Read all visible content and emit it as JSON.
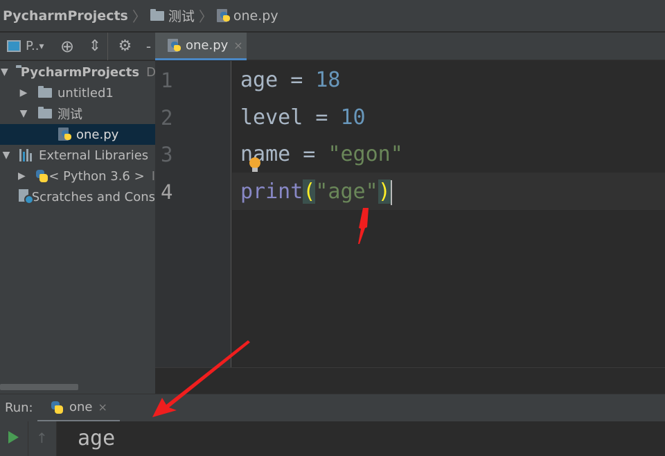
{
  "breadcrumb": {
    "project": "PycharmProjects",
    "folder": "测试",
    "file": "one.py"
  },
  "project_toolbar": {
    "view_label": "P..",
    "view_arrow": "▾",
    "locate_icon": "⊕",
    "collapse_icon": "⇕",
    "settings_icon": "⚙",
    "hide_icon": "-"
  },
  "tree": {
    "root": {
      "label": "PycharmProjects",
      "suffix": "D"
    },
    "items": [
      {
        "label": "untitled1"
      },
      {
        "label": "测试"
      },
      {
        "label": "one.py"
      },
      {
        "label": "External Libraries"
      },
      {
        "label": "< Python 3.6 >",
        "suffix": "I"
      },
      {
        "label": "Scratches and Cons"
      }
    ]
  },
  "editor": {
    "tab_label": "one.py",
    "tab_close": "×",
    "line_numbers": [
      "1",
      "2",
      "3",
      "4"
    ],
    "lines": [
      {
        "name": "age",
        "op": " = ",
        "value": "18"
      },
      {
        "name": "level",
        "op": " = ",
        "value": "10"
      },
      {
        "name": "name",
        "op": " = ",
        "value": "\"egon\""
      },
      {
        "func": "print",
        "open": "(",
        "arg": "\"age\"",
        "close": ")"
      }
    ]
  },
  "run": {
    "label": "Run:",
    "tab_label": "one",
    "tab_close": "×",
    "output": "age"
  },
  "colors": {
    "annotation": "#f01e1e",
    "number": "#6897bb",
    "string": "#6a8759",
    "builtin": "#8888c6"
  }
}
